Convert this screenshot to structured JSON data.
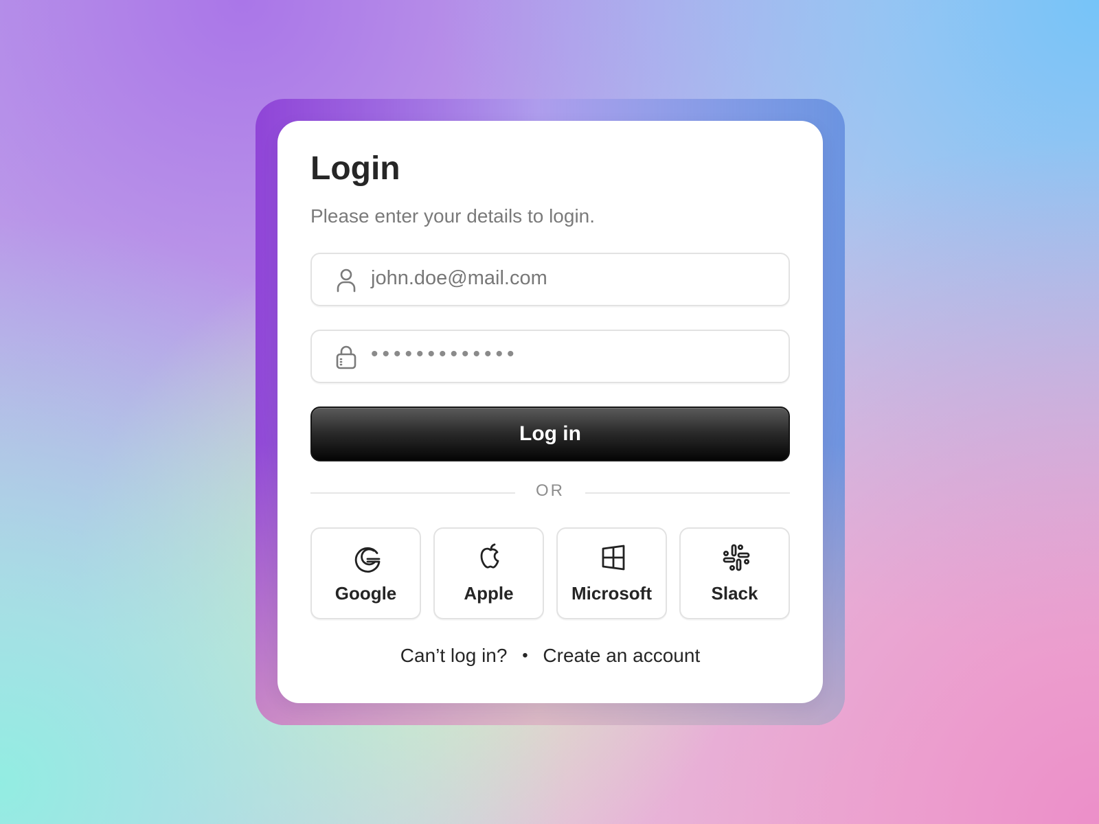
{
  "login": {
    "title": "Login",
    "subtitle": "Please enter your details to login.",
    "email_value": "john.doe@mail.com",
    "password_value": "•••••••••••••",
    "login_button": "Log in",
    "divider_text": "OR",
    "providers": [
      {
        "label": "Google",
        "icon": "google-icon"
      },
      {
        "label": "Apple",
        "icon": "apple-icon"
      },
      {
        "label": "Microsoft",
        "icon": "microsoft-icon"
      },
      {
        "label": "Slack",
        "icon": "slack-icon"
      }
    ],
    "cant_login_link": "Can’t log in?",
    "separator": "•",
    "create_account_link": "Create an account"
  }
}
